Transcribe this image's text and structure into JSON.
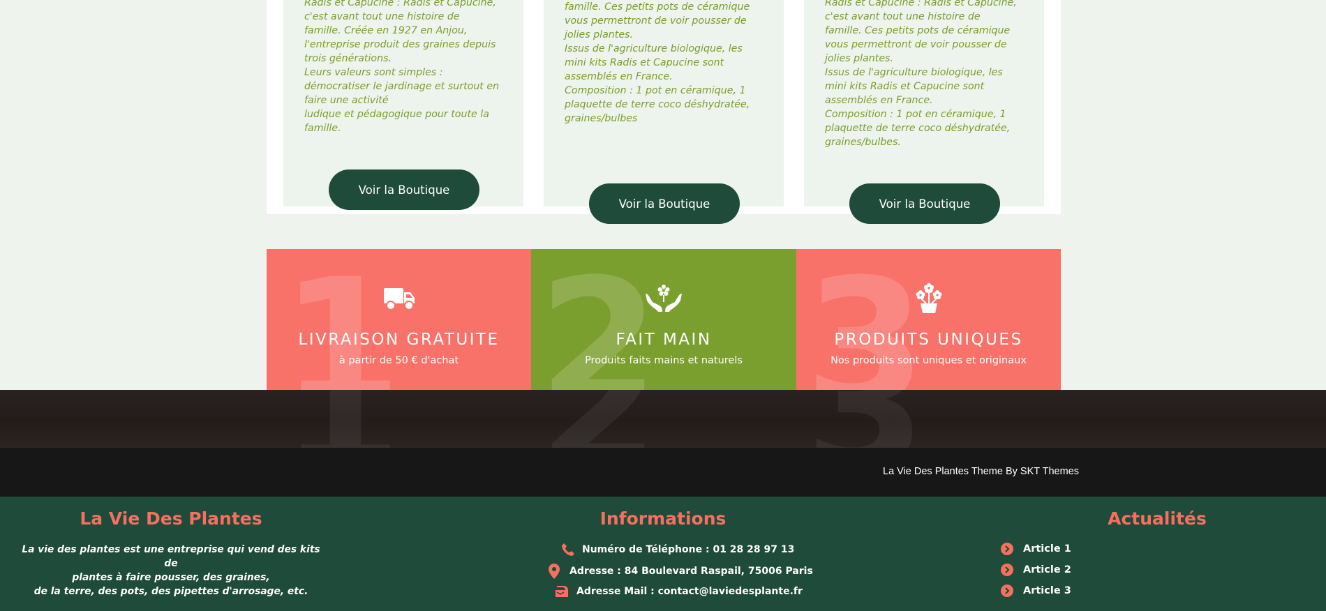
{
  "colors": {
    "page_bg": "#eef3ee",
    "green_dark": "#1e4b3a",
    "green_text": "#7a9e2c",
    "coral": "#f9726a",
    "olive": "#7b9f2e",
    "coral_title": "#f5705f"
  },
  "cards": [
    {
      "lines": [
        "Radis et Capucine : Radis et Capucine,",
        "c'est avant tout une histoire de",
        "famille. Créée en 1927 en Anjou,",
        "l'entreprise produit des graines depuis",
        "trois générations.",
        "Leurs valeurs sont simples :",
        "démocratiser le jardinage et surtout en",
        "faire une activité",
        "ludique et pédagogique pour toute la",
        "famille."
      ],
      "button": "Voir la Boutique"
    },
    {
      "lines": [
        "famille. Ces petits pots de céramique",
        "vous permettront de voir pousser de",
        "jolies plantes.",
        "Issus de l'agriculture biologique, les",
        "mini kits Radis et Capucine sont",
        "assemblés en France.",
        "Composition : 1 pot en céramique, 1",
        "plaquette de terre coco déshydratée,",
        "graines/bulbes"
      ],
      "button": "Voir la Boutique"
    },
    {
      "lines": [
        "Radis et Capucine : Radis et Capucine,",
        "c'est avant tout une histoire de",
        "famille. Ces petits pots de céramique",
        "vous permettront de voir pousser de",
        "jolies plantes.",
        "Issus de l'agriculture biologique, les",
        "mini kits Radis et Capucine sont",
        "assemblés en France.",
        "Composition : 1 pot en céramique, 1",
        "plaquette de terre coco déshydratée,",
        "graines/bulbes."
      ],
      "button": "Voir la Boutique"
    }
  ],
  "features": [
    {
      "number": "1",
      "icon": "truck-icon",
      "title": "LIVRAISON GRATUITE",
      "subtitle": "à partir de 50 € d'achat"
    },
    {
      "number": "2",
      "icon": "hands-flower-icon",
      "title": "FAIT MAIN",
      "subtitle": "Produits faits mains et naturels"
    },
    {
      "number": "3",
      "icon": "flower-pot-icon",
      "title": "PRODUITS UNIQUES",
      "subtitle": "Nos produits sont uniques et originaux"
    }
  ],
  "credit": "La Vie Des Plantes Theme By SKT Themes",
  "footer": {
    "about": {
      "title": "La Vie Des Plantes",
      "lines": [
        "La vie des plantes est une entreprise qui vend des kits de",
        "plantes à faire pousser, des graines,",
        "de la terre, des pots, des pipettes d'arrosage, etc."
      ]
    },
    "info": {
      "title": "Informations",
      "phone": "Numéro de Téléphone : 01 28 28 97 13",
      "address": "Adresse : 84 Boulevard Raspail, 75006 Paris",
      "email": "Adresse Mail : contact@laviedesplante.fr"
    },
    "news": {
      "title": "Actualités",
      "items": [
        "Article 1",
        "Article 2",
        "Article 3"
      ]
    }
  }
}
